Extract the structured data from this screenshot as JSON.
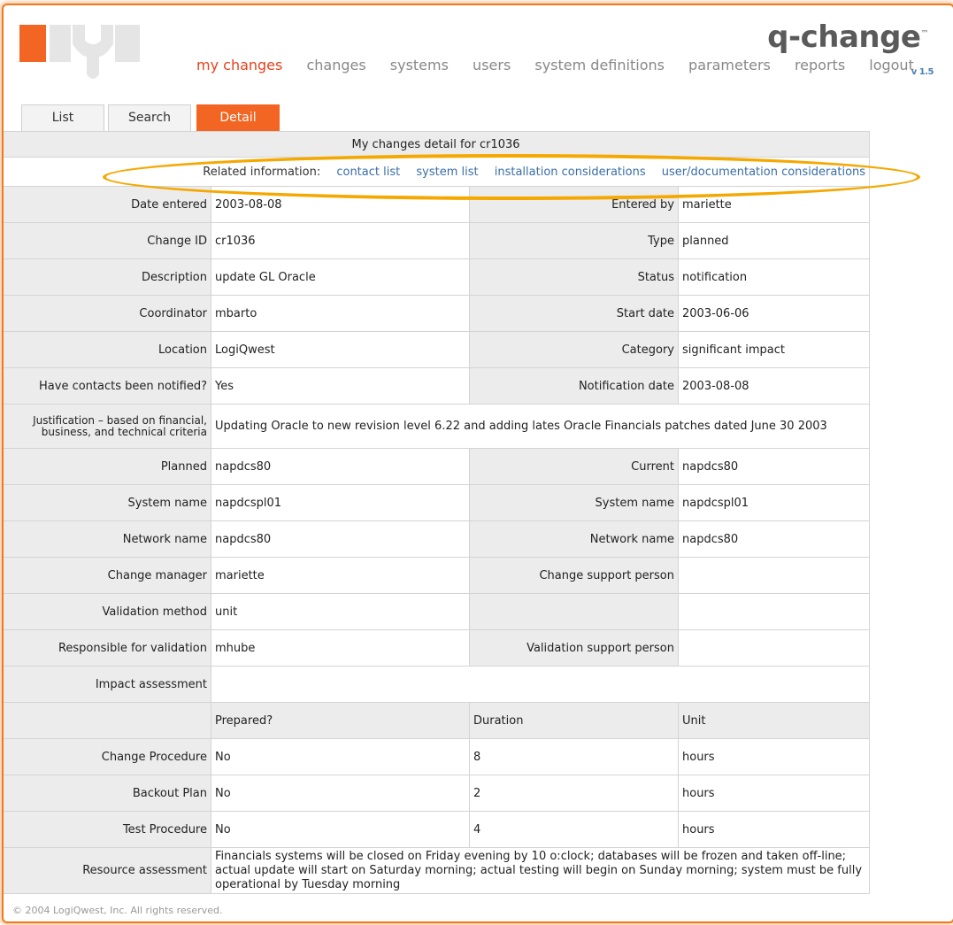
{
  "brand": {
    "name": "q-change",
    "trademark": "™",
    "version": "v 1.5"
  },
  "nav": [
    {
      "label": "my changes",
      "active": true
    },
    {
      "label": "changes",
      "active": false
    },
    {
      "label": "systems",
      "active": false
    },
    {
      "label": "users",
      "active": false
    },
    {
      "label": "system definitions",
      "active": false
    },
    {
      "label": "parameters",
      "active": false
    },
    {
      "label": "reports",
      "active": false
    },
    {
      "label": "logout",
      "active": false
    }
  ],
  "tabs": {
    "list": "List",
    "search": "Search",
    "detail": "Detail"
  },
  "detail": {
    "title": "My changes detail for cr1036",
    "related": {
      "label": "Related information:",
      "links": [
        "contact list",
        "system list",
        "installation considerations",
        "user/documentation considerations"
      ]
    },
    "date_entered": {
      "label": "Date entered",
      "value": "2003-08-08"
    },
    "entered_by": {
      "label": "Entered by",
      "value": "mariette"
    },
    "change_id": {
      "label": "Change ID",
      "value": "cr1036"
    },
    "type": {
      "label": "Type",
      "value": "planned"
    },
    "description": {
      "label": "Description",
      "value": "update GL Oracle"
    },
    "status": {
      "label": "Status",
      "value": "notification"
    },
    "coordinator": {
      "label": "Coordinator",
      "value": "mbarto"
    },
    "start_date": {
      "label": "Start date",
      "value": "2003-06-06"
    },
    "location": {
      "label": "Location",
      "value": "LogiQwest"
    },
    "category": {
      "label": "Category",
      "value": "significant impact"
    },
    "contacts_notified": {
      "label": "Have contacts been notified?",
      "value": "Yes"
    },
    "notification_date": {
      "label": "Notification date",
      "value": "2003-08-08"
    },
    "justification": {
      "label": "Justification – based on financial, business, and technical criteria",
      "value": "Updating Oracle to new revision level 6.22 and adding lates Oracle Financials patches dated June 30 2003"
    },
    "planned": {
      "label": "Planned",
      "value": "napdcs80"
    },
    "current": {
      "label": "Current",
      "value": "napdcs80"
    },
    "system_name_left": {
      "label": "System name",
      "value": "napdcspl01"
    },
    "system_name_right": {
      "label": "System name",
      "value": "napdcspl01"
    },
    "network_name_left": {
      "label": "Network name",
      "value": "napdcs80"
    },
    "network_name_right": {
      "label": "Network name",
      "value": "napdcs80"
    },
    "change_manager": {
      "label": "Change manager",
      "value": "mariette"
    },
    "change_support": {
      "label": "Change support person",
      "value": ""
    },
    "validation_method": {
      "label": "Validation method",
      "value": "unit"
    },
    "responsible_validation": {
      "label": "Responsible for validation",
      "value": "mhube"
    },
    "validation_support": {
      "label": "Validation support person",
      "value": ""
    },
    "impact_assessment": {
      "label": "Impact assessment",
      "value": ""
    },
    "proc_headers": {
      "prepared": "Prepared?",
      "duration": "Duration",
      "unit": "Unit"
    },
    "procedures": [
      {
        "label": "Change Procedure",
        "prepared": "No",
        "duration": "8",
        "unit": "hours"
      },
      {
        "label": "Backout Plan",
        "prepared": "No",
        "duration": "2",
        "unit": "hours"
      },
      {
        "label": "Test Procedure",
        "prepared": "No",
        "duration": "4",
        "unit": "hours"
      }
    ],
    "resource_assessment": {
      "label": "Resource assessment",
      "value": "Financials systems will be closed on Friday evening by 10 o:clock; databases will be frozen and taken off-line; actual update will start on Saturday morning; actual testing will begin on Sunday morning; system must be fully operational by Tuesday morning"
    }
  },
  "footer": "© 2004  LogiQwest, Inc. All rights reserved."
}
